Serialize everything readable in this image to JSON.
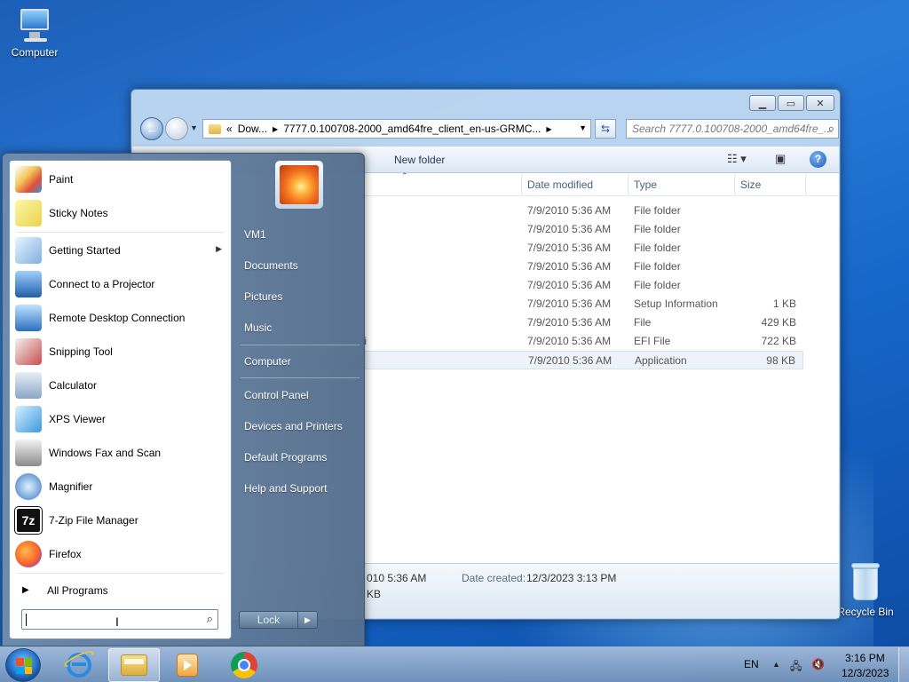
{
  "desktop": {
    "icons": [
      {
        "label": "Computer"
      },
      {
        "label": "Recycle Bin"
      }
    ]
  },
  "explorer": {
    "address": {
      "chevrons": "«",
      "segment1": "Dow...",
      "segment2": "7777.0.100708-2000_amd64fre_client_en-us-GRMC..."
    },
    "search_placeholder": "Search 7777.0.100708-2000_amd64fre_...",
    "toolbar": {
      "new_folder": "New folder"
    },
    "columns": {
      "date": "Date modified",
      "type": "Type",
      "size": "Size"
    },
    "files": [
      {
        "name": "",
        "date": "7/9/2010 5:36 AM",
        "type": "File folder",
        "size": ""
      },
      {
        "name": "",
        "date": "7/9/2010 5:36 AM",
        "type": "File folder",
        "size": ""
      },
      {
        "name": "",
        "date": "7/9/2010 5:36 AM",
        "type": "File folder",
        "size": ""
      },
      {
        "name": "",
        "date": "7/9/2010 5:36 AM",
        "type": "File folder",
        "size": ""
      },
      {
        "name": "",
        "date": "7/9/2010 5:36 AM",
        "type": "File folder",
        "size": ""
      },
      {
        "name": "",
        "date": "7/9/2010 5:36 AM",
        "type": "Setup Information",
        "size": "1 KB"
      },
      {
        "name": "",
        "date": "7/9/2010 5:36 AM",
        "type": "File",
        "size": "429 KB"
      },
      {
        "name": "fi",
        "date": "7/9/2010 5:36 AM",
        "type": "EFI File",
        "size": "722 KB"
      },
      {
        "name": "",
        "date": "7/9/2010 5:36 AM",
        "type": "Application",
        "size": "98 KB"
      }
    ],
    "details": {
      "modified_partial": "010 5:36 AM",
      "size_partial": "KB",
      "created_label": "Date created:",
      "created_value": "12/3/2023 3:13 PM"
    }
  },
  "start_menu": {
    "programs": [
      {
        "label": "Paint",
        "icon": "paint-icon"
      },
      {
        "label": "Sticky Notes",
        "icon": "sticky-notes-icon"
      },
      {
        "label": "Getting Started",
        "icon": "getting-started-icon"
      },
      {
        "label": "Connect to a Projector",
        "icon": "projector-icon"
      },
      {
        "label": "Remote Desktop Connection",
        "icon": "remote-desktop-icon"
      },
      {
        "label": "Snipping Tool",
        "icon": "snipping-tool-icon"
      },
      {
        "label": "Calculator",
        "icon": "calculator-icon"
      },
      {
        "label": "XPS Viewer",
        "icon": "xps-viewer-icon"
      },
      {
        "label": "Windows Fax and Scan",
        "icon": "fax-scan-icon"
      },
      {
        "label": "Magnifier",
        "icon": "magnifier-icon"
      },
      {
        "label": "7-Zip File Manager",
        "icon": "7zip-icon"
      },
      {
        "label": "Firefox",
        "icon": "firefox-icon"
      }
    ],
    "all_programs": "All Programs",
    "right": {
      "user": "VM1",
      "documents": "Documents",
      "pictures": "Pictures",
      "music": "Music",
      "computer": "Computer",
      "control_panel": "Control Panel",
      "devices": "Devices and Printers",
      "default_programs": "Default Programs",
      "help": "Help and Support"
    },
    "lock": "Lock"
  },
  "taskbar": {
    "language": "EN",
    "time": "3:16 PM",
    "date": "12/3/2023"
  }
}
